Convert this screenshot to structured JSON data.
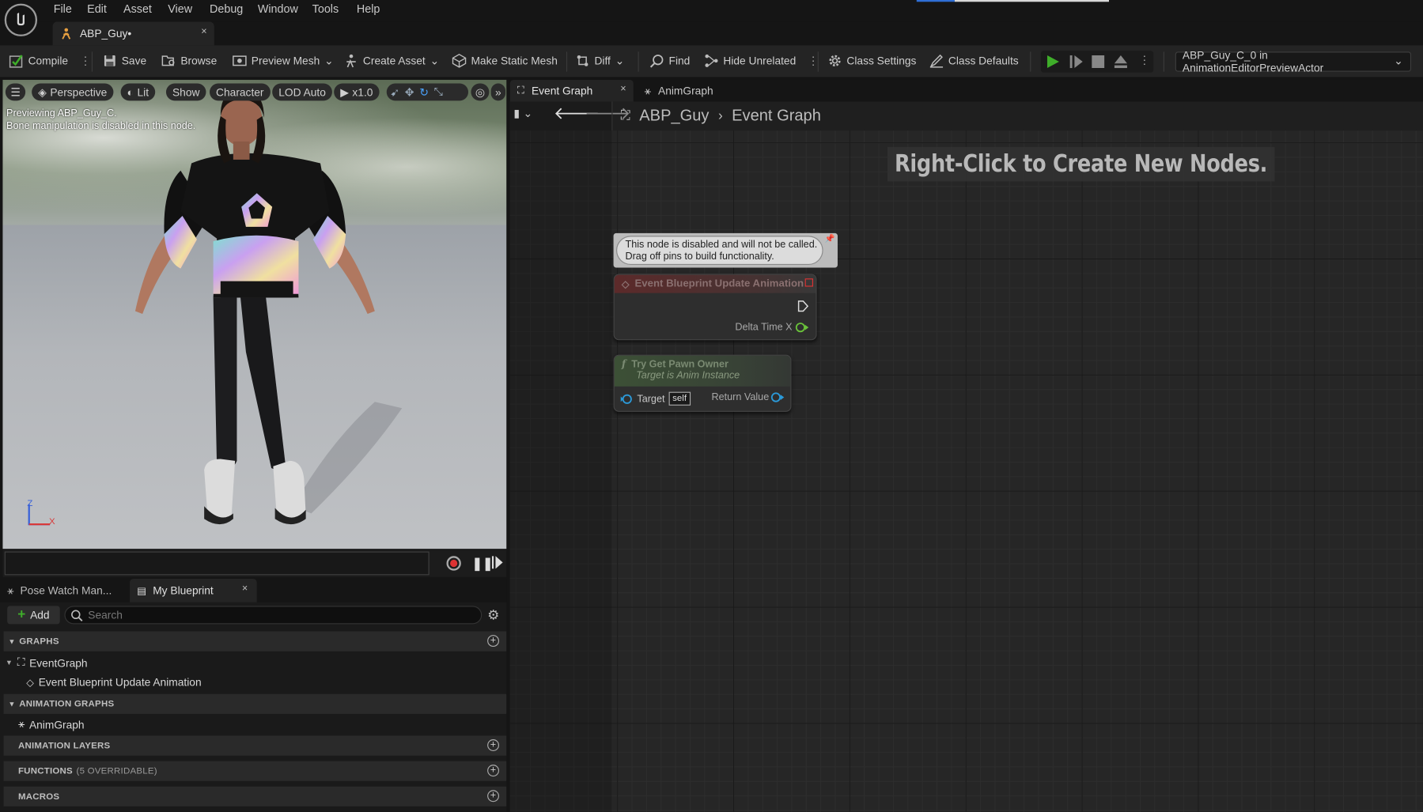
{
  "menu": {
    "items": [
      "File",
      "Edit",
      "Asset",
      "View",
      "Debug",
      "Window",
      "Tools",
      "Help"
    ]
  },
  "doc_tab": {
    "label": "ABP_Guy•",
    "close": "×"
  },
  "toolbar": {
    "compile": "Compile",
    "save": "Save",
    "browse": "Browse",
    "preview_mesh": "Preview Mesh",
    "create_asset": "Create Asset",
    "make_static_mesh": "Make Static Mesh",
    "diff": "Diff",
    "find": "Find",
    "hide_unrelated": "Hide Unrelated",
    "class_settings": "Class Settings",
    "class_defaults": "Class Defaults",
    "debug_object": "ABP_Guy_C_0 in AnimationEditorPreviewActor"
  },
  "viewport": {
    "perspective": "Perspective",
    "lit": "Lit",
    "show": "Show",
    "character": "Character",
    "lod": "LOD Auto",
    "speed": "x1.0",
    "info_line1": "Previewing ABP_Guy_C.",
    "info_line2": "Bone manipulation is disabled in this node.",
    "axis_z": "Z",
    "axis_x": "X"
  },
  "panel_tabs": {
    "pose_watch": "Pose Watch Man...",
    "my_blueprint": "My Blueprint",
    "close": "×"
  },
  "my_blueprint": {
    "add": "Add",
    "search_placeholder": "Search",
    "graphs_header": "GRAPHS",
    "event_graph": "EventGraph",
    "event_update": "Event Blueprint Update Animation",
    "anim_graphs_header": "ANIMATION GRAPHS",
    "anim_graph": "AnimGraph",
    "anim_layers_header": "ANIMATION LAYERS",
    "functions_header": "FUNCTIONS",
    "functions_note": "(5 OVERRIDABLE)",
    "macros_header": "MACROS"
  },
  "graph": {
    "tab_event": "Event Graph",
    "tab_anim": "AnimGraph",
    "tab_close": "×",
    "breadcrumb_root": "ABP_Guy",
    "breadcrumb_current": "Event Graph",
    "hint": "Right-Click to Create New Nodes.",
    "comment_line1": "This node is disabled and will not be called.",
    "comment_line2": "Drag off pins to build functionality.",
    "node1_title": "Event Blueprint Update Animation",
    "node1_pin": "Delta Time X",
    "node2_title": "Try Get Pawn Owner",
    "node2_subtitle": "Target is Anim Instance",
    "node2_target": "Target",
    "node2_self": "self",
    "node2_return": "Return Value"
  },
  "colors": {
    "accent_green": "#3fae2a",
    "exec_red": "#d33",
    "pin_blue": "#2b9ad9",
    "pin_green": "#6ac23a"
  }
}
